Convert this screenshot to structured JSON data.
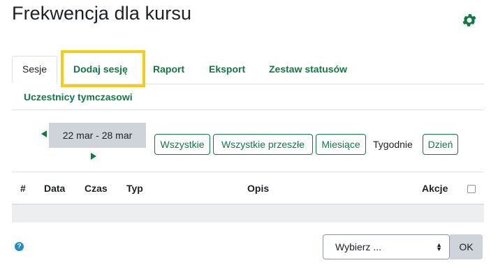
{
  "page": {
    "title": "Frekwencja dla kursu",
    "settings_icon": "gear-icon",
    "accent_color": "#0f7b43",
    "highlight_color": "#f7cc13"
  },
  "tabs": [
    {
      "label": "Sesje",
      "active": true
    },
    {
      "label": "Dodaj sesję",
      "active": false,
      "highlighted": true
    },
    {
      "label": "Raport",
      "active": false
    },
    {
      "label": "Eksport",
      "active": false
    },
    {
      "label": "Zestaw statusów",
      "active": false
    },
    {
      "label": "Uczestnicy tymczasowi",
      "active": false
    }
  ],
  "date_nav": {
    "range": "22 mar - 28 mar",
    "prev_icon": "triangle-left-icon",
    "next_icon": "triangle-right-icon"
  },
  "view_filters": [
    {
      "label": "Wszystkie",
      "selected": false
    },
    {
      "label": "Wszystkie przeszłe",
      "selected": false
    },
    {
      "label": "Miesiące",
      "selected": false
    },
    {
      "label": "Tygodnie",
      "selected": true
    },
    {
      "label": "Dzień",
      "selected": false
    }
  ],
  "table": {
    "columns": [
      "#",
      "Data",
      "Czas",
      "Typ",
      "Opis",
      "Akcje"
    ],
    "rows": []
  },
  "footer": {
    "help_icon": "question-circle-icon",
    "help_glyph": "?",
    "select_value": "Wybierz ...",
    "ok_label": "OK"
  }
}
